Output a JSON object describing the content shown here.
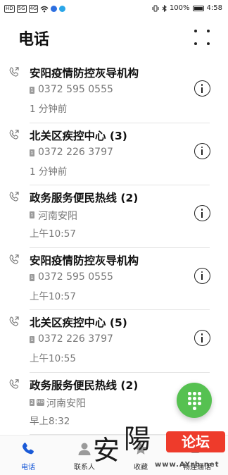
{
  "status_bar": {
    "left_chips": [
      "HD",
      "5G",
      "4G"
    ],
    "battery": "100%",
    "time": "4:58"
  },
  "page": {
    "title": "电话"
  },
  "calls": [
    {
      "name": "安阳疫情防控灰导机构",
      "detail": "0372 595 0555",
      "time": "1 分钟前",
      "hd": false
    },
    {
      "name": "北关区疾控中心 (3)",
      "detail": "0372 226 3797",
      "time": "1 分钟前",
      "hd": false
    },
    {
      "name": "政务服务便民热线 (2)",
      "detail": "河南安阳",
      "time": "上午10:57",
      "hd": false
    },
    {
      "name": "安阳疫情防控灰导机构",
      "detail": "0372 595 0555",
      "time": "上午10:57",
      "hd": false
    },
    {
      "name": "北关区疾控中心 (5)",
      "detail": "0372 226 3797",
      "time": "上午10:55",
      "hd": false
    },
    {
      "name": "政务服务便民热线 (2)",
      "detail": "河南安阳",
      "time": "早上8:32",
      "hd": true,
      "sim": "2",
      "hd_label": "HD"
    }
  ],
  "sim_label": "1",
  "bottom_nav": [
    {
      "label": "电话",
      "icon": "phone-icon",
      "active": true
    },
    {
      "label": "联系人",
      "icon": "contacts-icon",
      "active": false
    },
    {
      "label": "收藏",
      "icon": "favorites-icon",
      "active": false
    },
    {
      "label": "畅连通话",
      "icon": "meetime-icon",
      "active": false
    }
  ],
  "watermark": {
    "chars": [
      "安",
      "陽"
    ],
    "badge": "论坛",
    "url": "www.AYrb.net"
  },
  "colors": {
    "accent_blue": "#1a5ad7",
    "fab_green": "#56c151",
    "watermark_red": "#ee3b2b"
  }
}
